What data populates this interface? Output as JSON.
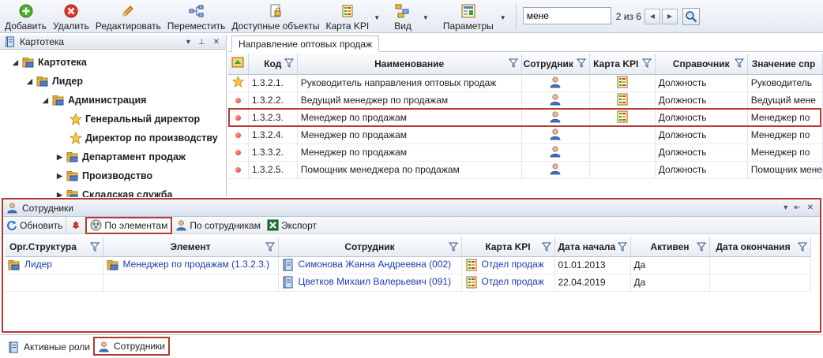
{
  "toolbar": {
    "add": "Добавить",
    "delete": "Удалить",
    "edit": "Редактировать",
    "move": "Переместить",
    "available": "Доступные объекты",
    "kpi_map": "Карта KPI",
    "view": "Вид",
    "params": "Параметры",
    "search_value": "мене",
    "search_count": "2 из 6"
  },
  "left_panel": {
    "title": "Картотека",
    "nodes": [
      {
        "label": "Картотека"
      },
      {
        "label": "Лидер"
      },
      {
        "label": "Администрация"
      },
      {
        "label": "Генеральный директор"
      },
      {
        "label": "Директор по производству"
      },
      {
        "label": "Департамент продаж"
      },
      {
        "label": "Производство"
      },
      {
        "label": "Складская служба"
      }
    ]
  },
  "main_grid": {
    "tab": "Направление оптовых продаж",
    "columns": {
      "code": "Код",
      "name": "Наименование",
      "employee": "Сотрудник",
      "kpi": "Карта KPI",
      "ref": "Справочник",
      "value": "Значение спр"
    },
    "rows": [
      {
        "code": "1.3.2.1.",
        "name": "Руководитель направления оптовых продаж",
        "ref": "Должность",
        "value": "Руководитель"
      },
      {
        "code": "1.3.2.2.",
        "name": "Ведущий менеджер по продажам",
        "ref": "Должность",
        "value": "Ведущий мене"
      },
      {
        "code": "1.3.2.3.",
        "name": "Менеджер по продажам",
        "ref": "Должность",
        "value": "Менеджер по"
      },
      {
        "code": "1.3.2.4.",
        "name": "Менеджер по продажам",
        "ref": "Должность",
        "value": "Менеджер по"
      },
      {
        "code": "1.3.3.2.",
        "name": "Менеджер по продажам",
        "ref": "Должность",
        "value": "Менеджер по"
      },
      {
        "code": "1.3.2.5.",
        "name": "Помощник менеджера по продажам",
        "ref": "Должность",
        "value": "Помощник мене"
      }
    ]
  },
  "bottom_panel": {
    "title": "Сотрудники",
    "toolbar": {
      "refresh": "Обновить",
      "by_elements": "По элементам",
      "by_employees": "По сотрудникам",
      "export": "Экспорт"
    },
    "columns": {
      "org": "Орг.Структура",
      "element": "Элемент",
      "employee": "Сотрудник",
      "kpi": "Карта KPI",
      "start": "Дата начала",
      "active": "Активен",
      "end": "Дата окончания"
    },
    "org_value": "Лидер",
    "element_value": "Менеджер по продажам  (1.3.2.3.)",
    "rows": [
      {
        "employee": "Симонова Жанна Андреевна  (002)",
        "kpi": "Отдел продаж",
        "start": "01.01.2013",
        "active": "Да"
      },
      {
        "employee": "Цветков Михаил Валерьевич  (091)",
        "kpi": "Отдел продаж",
        "start": "22.04.2019",
        "active": "Да"
      }
    ]
  },
  "status_tabs": {
    "roles": "Активные роли",
    "employees": "Сотрудники"
  }
}
